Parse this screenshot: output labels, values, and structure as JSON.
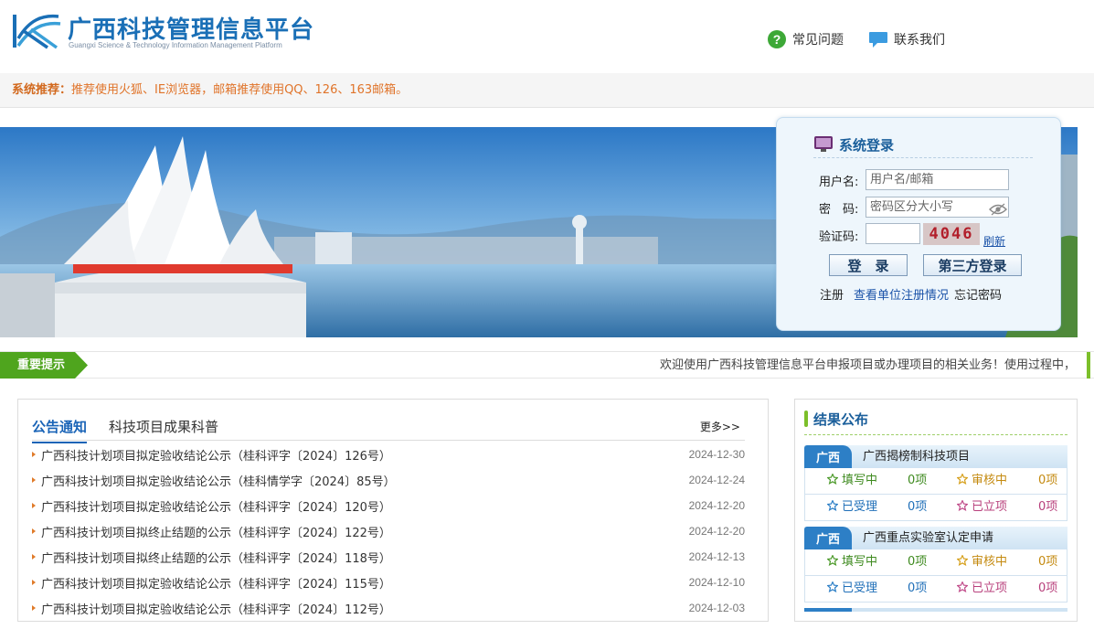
{
  "header": {
    "title": "广西科技管理信息平台",
    "subtitle": "Guangxi Science & Technology Information Management Platform",
    "faq_label": "常见问题",
    "contact_label": "联系我们"
  },
  "recommend": {
    "label": "系统推荐：",
    "text": "推荐使用火狐、IE浏览器，邮箱推荐使用QQ、126、163邮箱。"
  },
  "login": {
    "title": "系统登录",
    "username_label": "用户名:",
    "username_placeholder": "用户名/邮箱",
    "password_label": "密　码:",
    "password_placeholder": "密码区分大小写",
    "captcha_label": "验证码:",
    "captcha_value": "4046",
    "refresh_label": "刷新",
    "login_button": "登　录",
    "third_party_button": "第三方登录",
    "register_link": "注册",
    "check_unit_link": "查看单位注册情况",
    "forgot_link": "忘记密码"
  },
  "notice": {
    "tag": "重要提示",
    "text": "欢迎使用广西科技管理信息平台申报项目或办理项目的相关业务！使用过程中，如有"
  },
  "announcements": {
    "tabs": [
      "公告通知",
      "科技项目成果科普"
    ],
    "more_label": "更多>>",
    "items": [
      {
        "title": "广西科技计划项目拟定验收结论公示（桂科评字〔2024〕126号）",
        "date": "2024-12-30"
      },
      {
        "title": "广西科技计划项目拟定验收结论公示（桂科情学字〔2024〕85号）",
        "date": "2024-12-24"
      },
      {
        "title": "广西科技计划项目拟定验收结论公示（桂科评字〔2024〕120号）",
        "date": "2024-12-20"
      },
      {
        "title": "广西科技计划项目拟终止结题的公示（桂科评字〔2024〕122号）",
        "date": "2024-12-20"
      },
      {
        "title": "广西科技计划项目拟终止结题的公示（桂科评字〔2024〕118号）",
        "date": "2024-12-13"
      },
      {
        "title": "广西科技计划项目拟定验收结论公示（桂科评字〔2024〕115号）",
        "date": "2024-12-10"
      },
      {
        "title": "广西科技计划项目拟定验收结论公示（桂科评字〔2024〕112号）",
        "date": "2024-12-03"
      }
    ]
  },
  "results": {
    "title": "结果公布",
    "blocks": [
      {
        "tag": "广西",
        "name": "广西揭榜制科技项目",
        "rows": [
          [
            {
              "label": "填写中",
              "count": "0项"
            },
            {
              "label": "审核中",
              "count": "0项"
            }
          ],
          [
            {
              "label": "已受理",
              "count": "0项"
            },
            {
              "label": "已立项",
              "count": "0项"
            }
          ]
        ]
      },
      {
        "tag": "广西",
        "name": "广西重点实验室认定申请",
        "rows": [
          [
            {
              "label": "填写中",
              "count": "0项"
            },
            {
              "label": "审核中",
              "count": "0项"
            }
          ],
          [
            {
              "label": "已受理",
              "count": "0项"
            },
            {
              "label": "已立项",
              "count": "0项"
            }
          ]
        ]
      }
    ]
  },
  "colors": {
    "brand_blue": "#1a6fb6",
    "accent_orange": "#e0742a",
    "notice_green": "#4fa51e",
    "star_green": "#4c9a2a",
    "star_orange": "#d6a01c",
    "star_blue": "#2d7fc6",
    "star_pink": "#c04c8a"
  }
}
